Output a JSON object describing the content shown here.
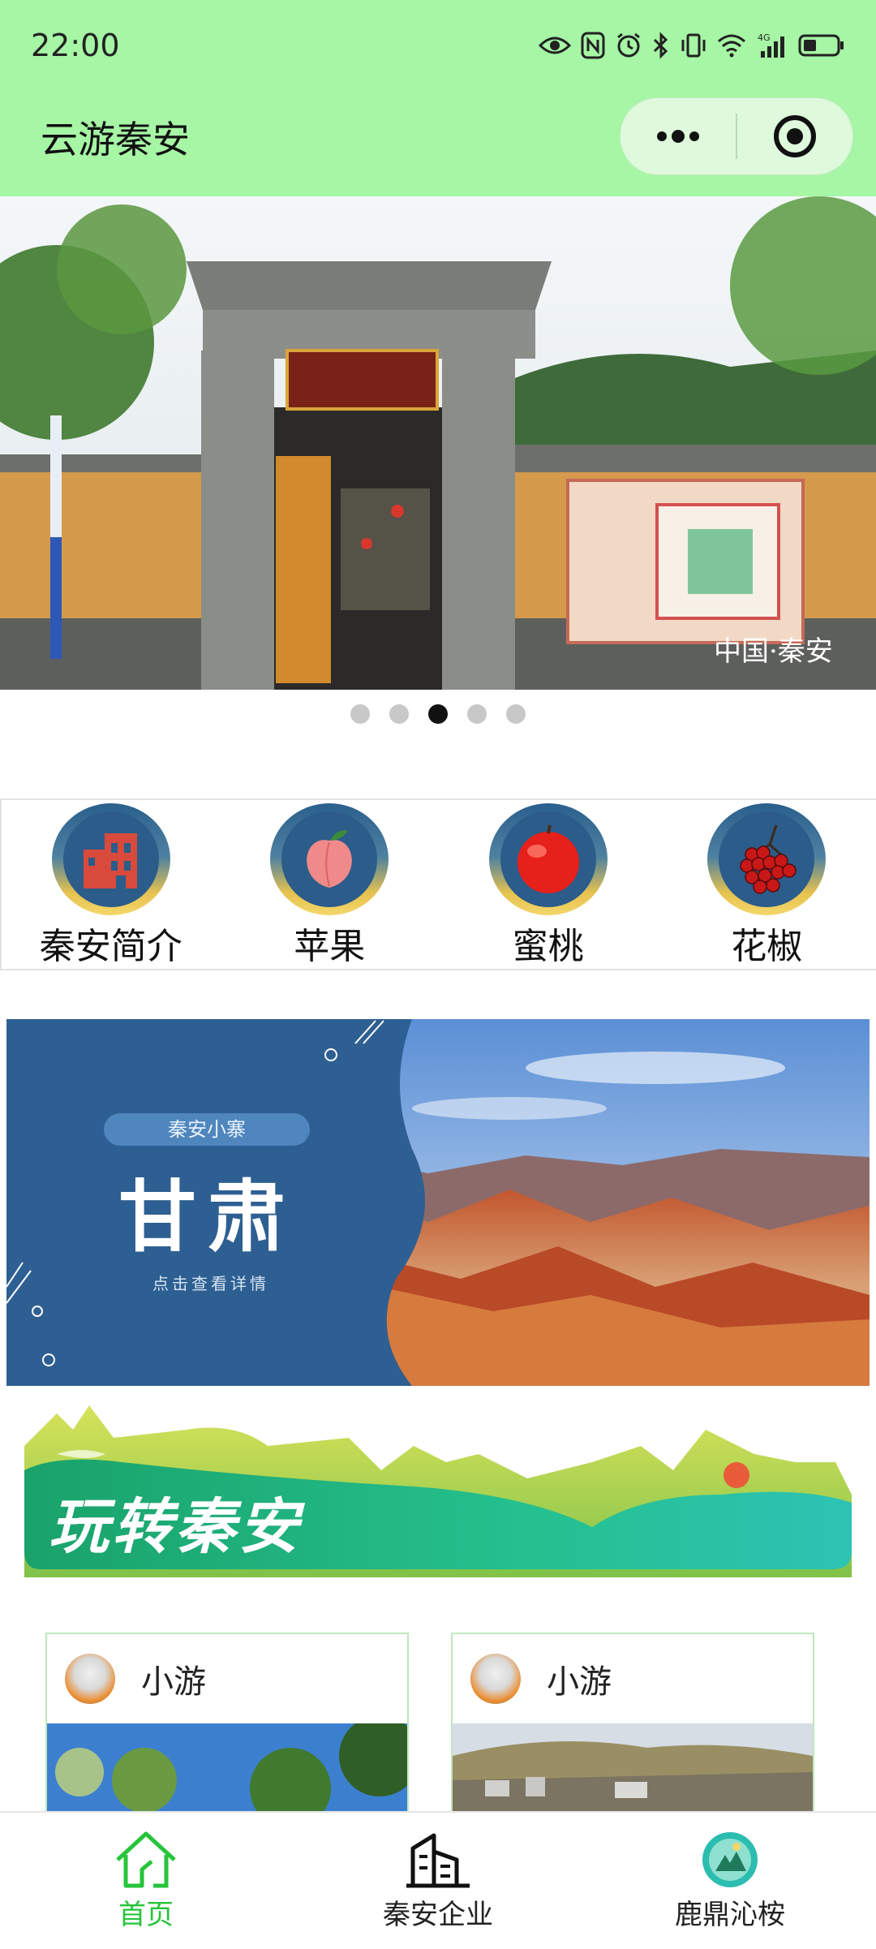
{
  "status_bar": {
    "time": "22:00",
    "network": "4G"
  },
  "nav": {
    "title": "云游秦安"
  },
  "hero": {
    "slide_count": 5,
    "active_index": 2,
    "watermark": "中国·秦安"
  },
  "categories": [
    {
      "label": "秦安简介",
      "icon": "building-icon"
    },
    {
      "label": "苹果",
      "icon": "peach-icon"
    },
    {
      "label": "蜜桃",
      "icon": "apple-icon"
    },
    {
      "label": "花椒",
      "icon": "pepper-icon"
    }
  ],
  "promo": {
    "tag": "秦安小寨",
    "title": "甘肃",
    "subtitle": "点击查看详情"
  },
  "play_banner": {
    "title": "玩转秦安"
  },
  "posts": [
    {
      "name": "小游"
    },
    {
      "name": "小游"
    }
  ],
  "tabbar": [
    {
      "label": "首页",
      "icon": "home-icon",
      "active": true
    },
    {
      "label": "秦安企业",
      "icon": "building-outline-icon",
      "active": false
    },
    {
      "label": "鹿鼎沁桉",
      "icon": "logo-icon",
      "active": false
    }
  ],
  "colors": {
    "header_bg": "#a6f6a5",
    "accent": "#26c43a",
    "promo_blue": "#2e5f92"
  }
}
